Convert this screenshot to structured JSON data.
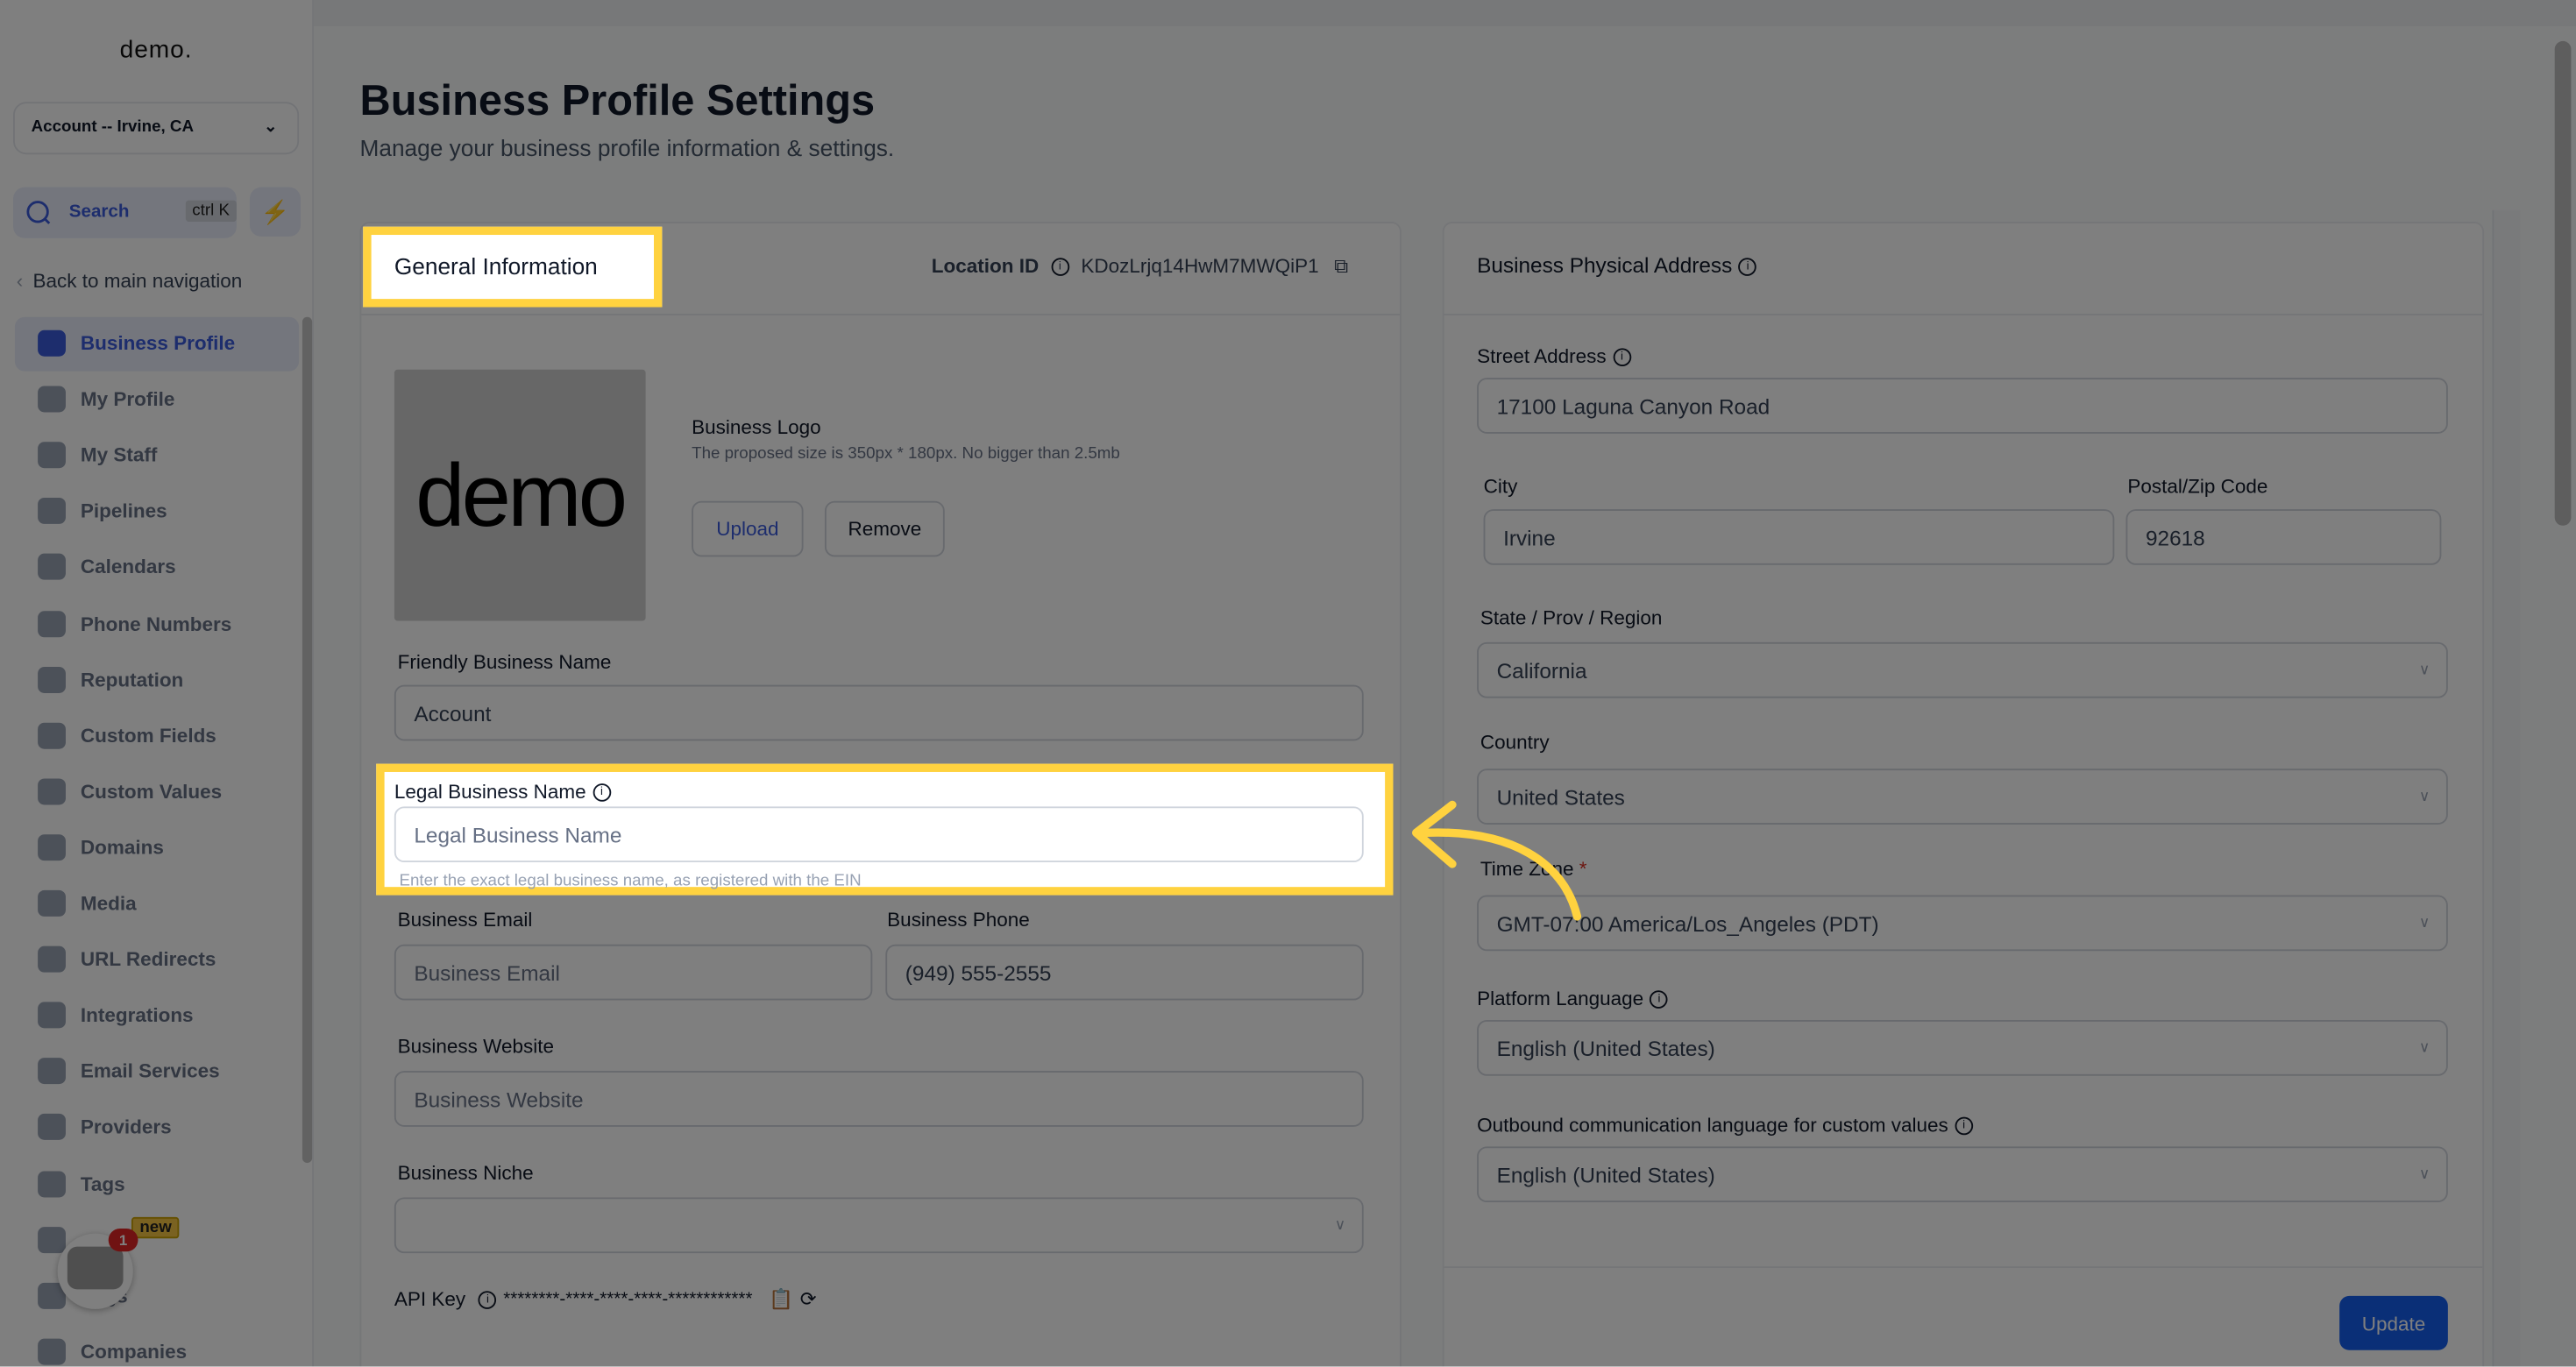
{
  "sidebar": {
    "logo": "demo.",
    "account_switcher": "Account -- Irvine, CA",
    "search_label": "Search",
    "search_shortcut": "ctrl K",
    "back_label": "Back to main navigation",
    "items": [
      {
        "label": "Business Profile",
        "active": true
      },
      {
        "label": "My Profile"
      },
      {
        "label": "My Staff"
      },
      {
        "label": "Pipelines"
      },
      {
        "label": "Calendars"
      },
      {
        "label": "Phone Numbers"
      },
      {
        "label": "Reputation"
      },
      {
        "label": "Custom Fields"
      },
      {
        "label": "Custom Values"
      },
      {
        "label": "Domains"
      },
      {
        "label": "Media"
      },
      {
        "label": "URL Redirects"
      },
      {
        "label": "Integrations"
      },
      {
        "label": "Email Services"
      },
      {
        "label": "Providers"
      },
      {
        "label": "Tags"
      },
      {
        "label": ""
      },
      {
        "label": "Logs"
      },
      {
        "label": "Companies"
      }
    ],
    "new_badge": "new",
    "chat_badge_count": "1"
  },
  "page": {
    "title": "Business Profile Settings",
    "subtitle": "Manage your business profile information & settings."
  },
  "general": {
    "title": "General Information",
    "location_id_label": "Location ID",
    "location_id": "KDozLrjq14HwM7MWQiP1",
    "logo_image_text": "demo",
    "logo_label": "Business Logo",
    "logo_hint": "The proposed size is 350px * 180px. No bigger than 2.5mb",
    "upload": "Upload",
    "remove": "Remove",
    "friendly_name_label": "Friendly Business Name",
    "friendly_name_value": "Account",
    "legal_name_label": "Legal Business Name",
    "legal_name_placeholder": "Legal Business Name",
    "legal_name_hint": "Enter the exact legal business name, as registered with the EIN",
    "email_label": "Business Email",
    "email_placeholder": "Business Email",
    "phone_label": "Business Phone",
    "phone_value": "(949) 555-2555",
    "website_label": "Business Website",
    "website_placeholder": "Business Website",
    "niche_label": "Business Niche",
    "niche_value": "",
    "api_key_label": "API Key",
    "api_key_value": "********-****-****-****-************"
  },
  "address": {
    "title": "Business Physical Address",
    "street_label": "Street Address",
    "street_value": "17100 Laguna Canyon Road",
    "city_label": "City",
    "city_value": "Irvine",
    "zip_label": "Postal/Zip Code",
    "zip_value": "92618",
    "state_label": "State / Prov / Region",
    "state_value": "California",
    "country_label": "Country",
    "country_value": "United States",
    "timezone_label": "Time Zone",
    "required_mark": "*",
    "timezone_value": "GMT-07:00 America/Los_Angeles (PDT)",
    "platform_lang_label": "Platform Language",
    "platform_lang_value": "English (United States)",
    "outbound_lang_label": "Outbound communication language for custom values",
    "outbound_lang_value": "English (United States)",
    "update": "Update"
  },
  "colors": {
    "accent": "#155eef",
    "highlight": "#ffd23f",
    "required": "#d92d20"
  }
}
